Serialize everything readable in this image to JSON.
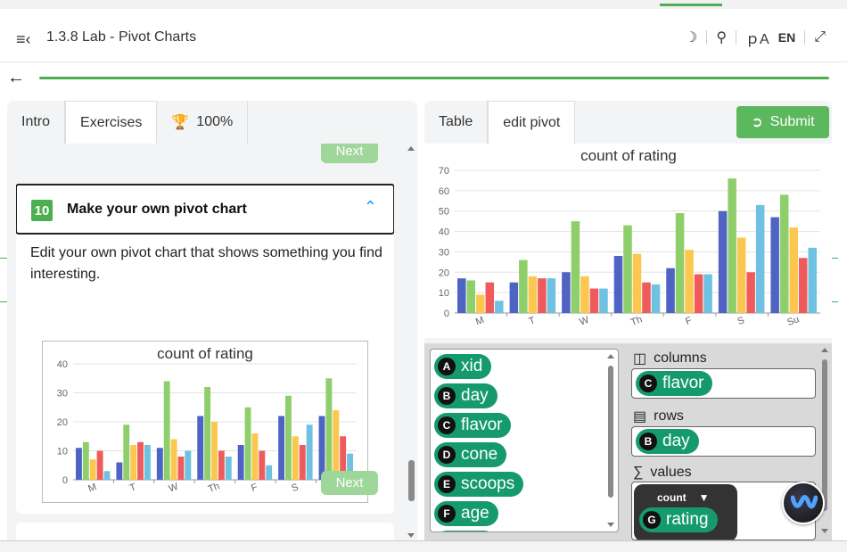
{
  "header": {
    "title": "1.3.8 Lab - Pivot Charts",
    "lang": "EN"
  },
  "left_tabs": [
    {
      "label": "Intro"
    },
    {
      "label": "Exercises"
    },
    {
      "label": "100%"
    }
  ],
  "exercise": {
    "number": "10",
    "title": "Make your own pivot chart",
    "text": "Edit your own pivot chart that shows something you find interesting.",
    "next_label": "Next"
  },
  "right_tabs": [
    {
      "label": "Table"
    },
    {
      "label": "edit pivot"
    }
  ],
  "submit_label": "Submit",
  "attributes": [
    {
      "letter": "A",
      "name": "xid"
    },
    {
      "letter": "B",
      "name": "day"
    },
    {
      "letter": "C",
      "name": "flavor"
    },
    {
      "letter": "D",
      "name": "cone"
    },
    {
      "letter": "E",
      "name": "scoops"
    },
    {
      "letter": "F",
      "name": "age"
    }
  ],
  "pivot": {
    "columns_label": "columns",
    "rows_label": "rows",
    "values_label": "values",
    "column_field": {
      "letter": "C",
      "name": "flavor"
    },
    "row_field": {
      "letter": "B",
      "name": "day"
    },
    "value_agg": "count",
    "value_field": {
      "letter": "G",
      "name": "rating"
    }
  },
  "chart_data": [
    {
      "type": "bar",
      "title": "count of rating",
      "categories": [
        "M",
        "T",
        "W",
        "Th",
        "F",
        "S",
        "Su"
      ],
      "ylim": [
        0,
        40
      ],
      "yticks": [
        0,
        10,
        20,
        30,
        40
      ],
      "colors": [
        "#4e63c4",
        "#8ecf6b",
        "#fbc74f",
        "#ef5b5b",
        "#6ec1e0"
      ],
      "series": [
        {
          "values": [
            11,
            6,
            11,
            22,
            12,
            22,
            22
          ]
        },
        {
          "values": [
            13,
            19,
            34,
            32,
            25,
            29,
            35
          ]
        },
        {
          "values": [
            7,
            12,
            14,
            20,
            16,
            15,
            24
          ]
        },
        {
          "values": [
            10,
            13,
            8,
            10,
            10,
            12,
            15
          ]
        },
        {
          "values": [
            3,
            12,
            10,
            8,
            5,
            19,
            9
          ]
        }
      ]
    },
    {
      "type": "bar",
      "title": "count of rating",
      "categories": [
        "M",
        "T",
        "W",
        "Th",
        "F",
        "S",
        "Su"
      ],
      "ylim": [
        0,
        70
      ],
      "yticks": [
        0,
        10,
        20,
        30,
        40,
        50,
        60,
        70
      ],
      "colors": [
        "#4e63c4",
        "#8ecf6b",
        "#fbc74f",
        "#ef5b5b",
        "#6ec1e0"
      ],
      "series": [
        {
          "values": [
            17,
            15,
            20,
            28,
            22,
            50,
            47
          ]
        },
        {
          "values": [
            16,
            26,
            45,
            43,
            49,
            66,
            58
          ]
        },
        {
          "values": [
            9,
            18,
            18,
            29,
            31,
            37,
            42
          ]
        },
        {
          "values": [
            15,
            17,
            12,
            15,
            19,
            20,
            27
          ]
        },
        {
          "values": [
            6,
            17,
            12,
            14,
            19,
            53,
            32
          ]
        }
      ]
    }
  ]
}
